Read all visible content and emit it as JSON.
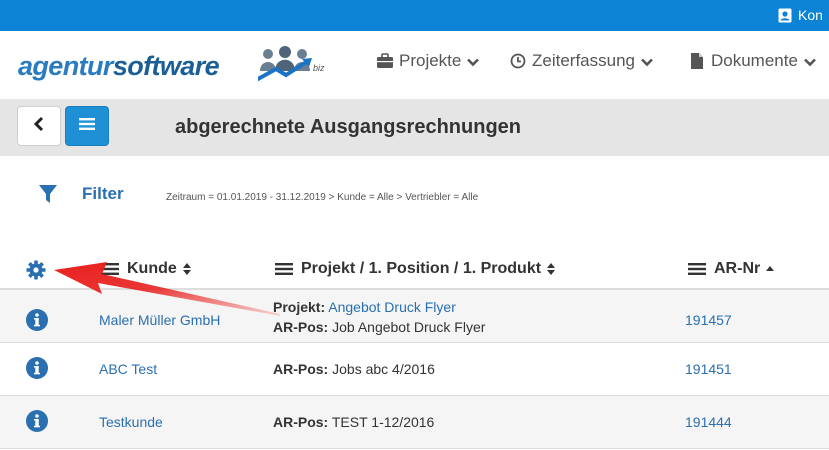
{
  "topbar": {
    "contact_label": "Kon"
  },
  "logo": {
    "word1": "agentur",
    "word2": "software",
    "tld": "biz"
  },
  "nav": [
    {
      "label": "Projekte",
      "icon": "briefcase-icon"
    },
    {
      "label": "Zeiterfassung",
      "icon": "clock-icon"
    },
    {
      "label": "Dokumente",
      "icon": "document-icon"
    }
  ],
  "title": {
    "text": "abgerechnete Ausgangsrechnungen"
  },
  "filter": {
    "label": "Filter",
    "summary": "Zeitraum = 01.01.2019 - 31.12.2019 > Kunde = Alle > Vertriebler = Alle"
  },
  "table": {
    "headers": {
      "kunde": "Kunde",
      "projekt": "Projekt / 1. Position / 1. Produkt",
      "arnr": "AR-Nr"
    },
    "rows": [
      {
        "kunde": "Maler Müller GmbH",
        "projekt_label": "Projekt:",
        "projekt_value": "Angebot Druck Flyer",
        "arpos_label": "AR-Pos:",
        "arpos_value": "Job Angebot Druck Flyer",
        "arnr": "191457"
      },
      {
        "kunde": "ABC Test",
        "arpos_label": "AR-Pos:",
        "arpos_value": "Jobs abc 4/2016",
        "arnr": "191451"
      },
      {
        "kunde": "Testkunde",
        "arpos_label": "AR-Pos:",
        "arpos_value": "TEST 1-12/2016",
        "arnr": "191444"
      }
    ]
  },
  "colors": {
    "brand_blue": "#0d83d6",
    "link_blue": "#2a6fb0",
    "annotation_red": "#e8201e"
  }
}
